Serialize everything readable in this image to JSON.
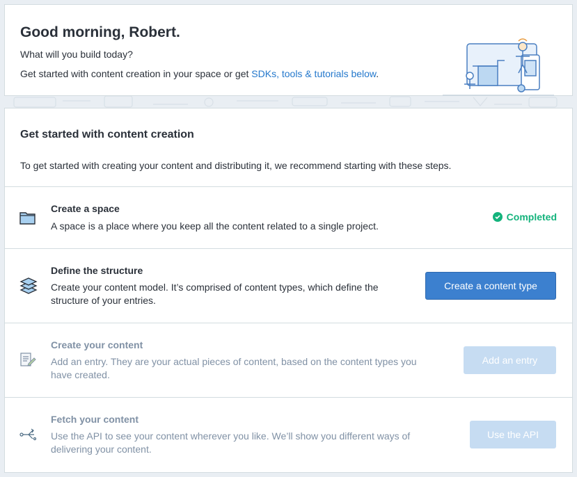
{
  "welcome": {
    "title": "Good morning, Robert.",
    "subtitle": "What will you build today?",
    "line_prefix": "Get started with content creation in your space or get ",
    "line_link": "SDKs, tools & tutorials below",
    "line_suffix": "."
  },
  "section": {
    "title": "Get started with content creation",
    "description": "To get started with creating your content and distributing it, we recommend starting with these steps."
  },
  "steps": [
    {
      "title": "Create a space",
      "description": "A space is a place where you keep all the content related to a single project.",
      "status": "Completed",
      "icon": "folder-icon"
    },
    {
      "title": "Define the structure",
      "description": "Create your content model. It’s comprised of content types, which define the structure of your entries.",
      "button": "Create a content type",
      "icon": "layers-icon"
    },
    {
      "title": "Create your content",
      "description": "Add an entry. They are your actual pieces of content, based on the content types you have created.",
      "button": "Add an entry",
      "icon": "edit-document-icon"
    },
    {
      "title": "Fetch your content",
      "description": "Use the API to see your content wherever you like. We’ll show you different ways of delivering your content.",
      "button": "Use the API",
      "icon": "api-branch-icon"
    }
  ],
  "colors": {
    "accent": "#3c80cf",
    "link": "#2478cc",
    "success": "#14b37c",
    "disabled_button": "#c6dcf2",
    "disabled_text": "#8091a5",
    "background": "#e9eef3"
  }
}
